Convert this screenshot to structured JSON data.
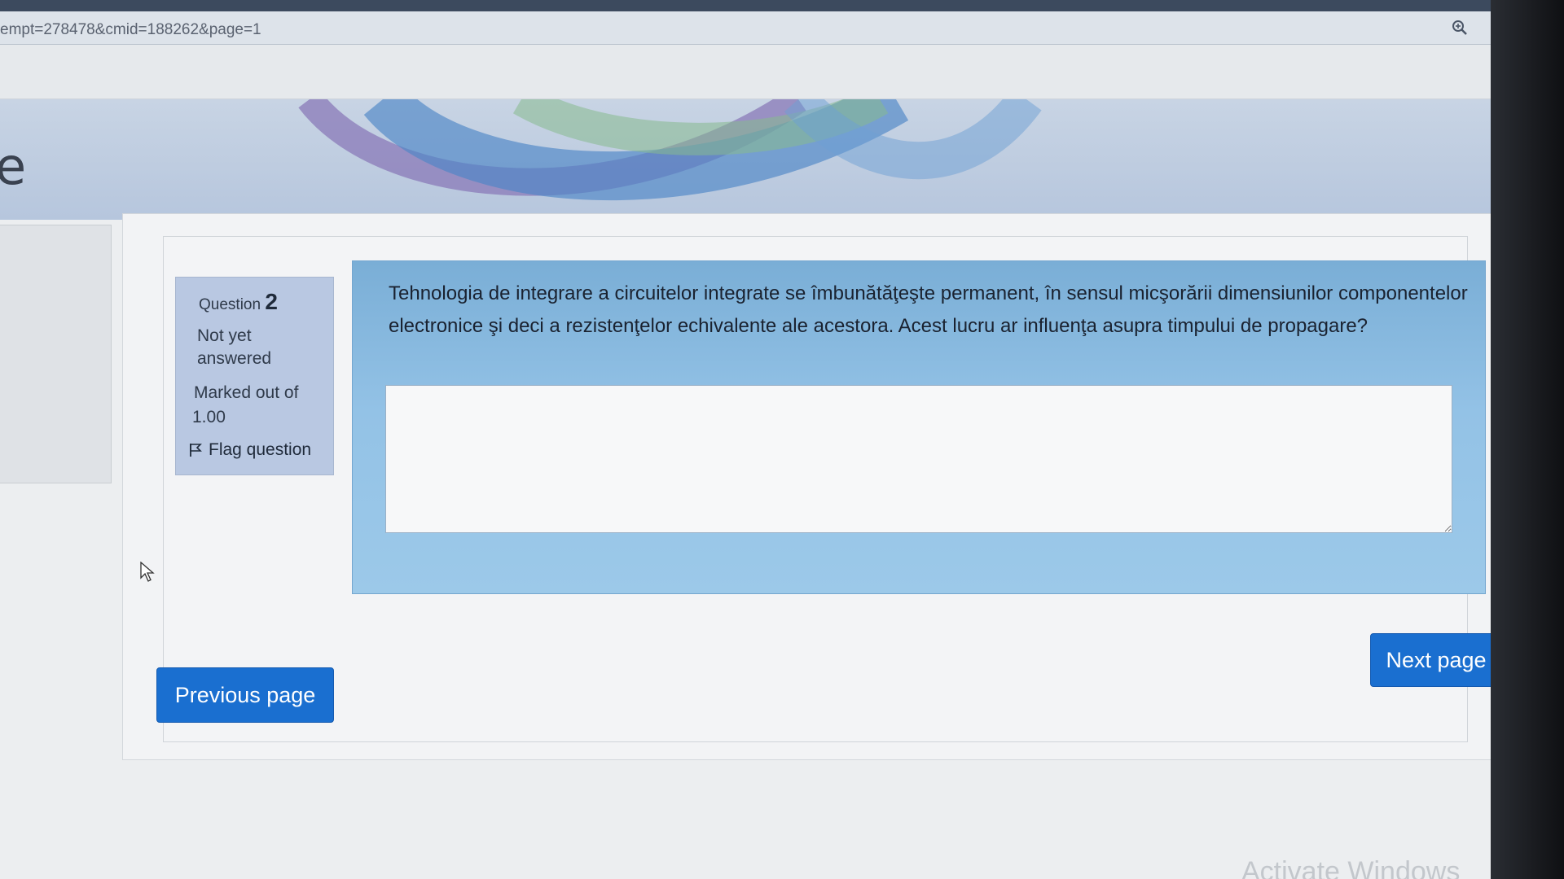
{
  "browser": {
    "url_fragment": "empt=278478&cmid=188262&page=1",
    "zoom_icon": "zoom-in-icon"
  },
  "site": {
    "header_letter": "e"
  },
  "question": {
    "label": "Question",
    "number": "2",
    "status": "Not yet answered",
    "marks_label": "Marked out of",
    "marks_value": "1.00",
    "flag_label": "Flag question",
    "flag_icon": "flag-icon",
    "text": "Tehnologia de integrare a circuitelor integrate se îmbunătăţeşte permanent, în sensul micşorării dimensiunilor componentelor electronice şi deci a rezistenţelor echivalente ale acestora. Acest lucru ar influenţa asupra timpului de propagare?",
    "answer_value": ""
  },
  "navigation": {
    "previous_label": "Previous page",
    "next_label": "Next page"
  },
  "os": {
    "watermark": "Activate Windows"
  },
  "colors": {
    "button_blue": "#1a6fd0",
    "info_box": "#b9c8e2",
    "formulation_bg": "#93c2e6"
  }
}
